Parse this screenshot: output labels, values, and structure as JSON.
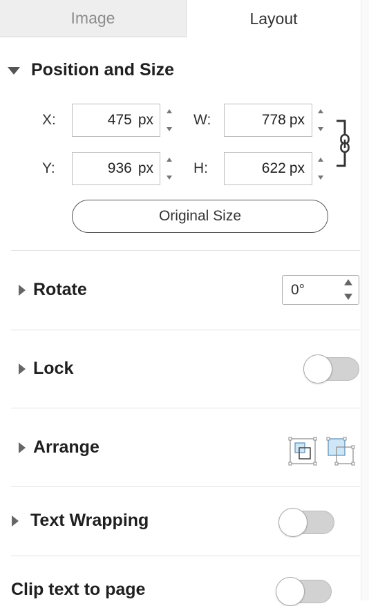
{
  "tabs": [
    {
      "label": "Image",
      "active": false
    },
    {
      "label": "Layout",
      "active": true
    }
  ],
  "position_size": {
    "title": "Position and Size",
    "x_label": "X:",
    "x_value": "475",
    "y_label": "Y:",
    "y_value": "936",
    "w_label": "W:",
    "w_value": "778",
    "h_label": "H:",
    "h_value": "622",
    "unit": "px",
    "original_size_label": "Original Size",
    "aspect_lock_icon": "chain-link-icon"
  },
  "rotate": {
    "title": "Rotate",
    "value": "0°"
  },
  "lock": {
    "title": "Lock",
    "toggle_on": false
  },
  "arrange": {
    "title": "Arrange",
    "icons": [
      "bring-to-front-icon",
      "send-to-back-icon"
    ]
  },
  "text_wrapping": {
    "title": "Text Wrapping",
    "toggle_on": false
  },
  "clip_text": {
    "title": "Clip text to page",
    "toggle_on": false
  },
  "colors": {
    "accent_fill": "#cfe6f7",
    "toggle_track": "#d2d2d2",
    "text": "#1f1f1f"
  }
}
